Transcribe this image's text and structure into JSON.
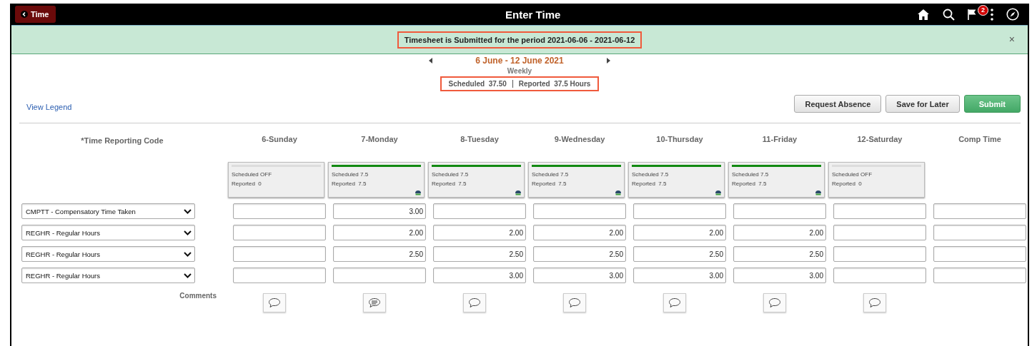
{
  "header": {
    "back_label": "Time",
    "title": "Enter Time",
    "notification_count": "2"
  },
  "banner": {
    "message": "Timesheet is Submitted for the period 2021-06-06 - 2021-06-12",
    "close": "×"
  },
  "period": {
    "range": "6 June - 12 June 2021",
    "view": "Weekly",
    "scheduled_label": "Scheduled",
    "scheduled_value": "37.50",
    "reported_label": "Reported",
    "reported_value": "37.5 Hours"
  },
  "view_legend": "View Legend",
  "buttons": [
    {
      "label": "Request Absence",
      "kind": "secondary"
    },
    {
      "label": "Save for Later",
      "kind": "secondary"
    },
    {
      "label": "Submit",
      "kind": "primary"
    }
  ],
  "code_column": "*Time Reporting Code",
  "columns": [
    "6-Sunday",
    "7-Monday",
    "8-Tuesday",
    "9-Wednesday",
    "10-Thursday",
    "11-Friday",
    "12-Saturday",
    "Comp Time"
  ],
  "day_summaries": [
    {
      "scheduled": "Scheduled OFF",
      "reported": "Reported  0",
      "complete": false
    },
    {
      "scheduled": "Scheduled 7.5",
      "reported": "Reported  7.5",
      "complete": true
    },
    {
      "scheduled": "Scheduled 7.5",
      "reported": "Reported  7.5",
      "complete": true
    },
    {
      "scheduled": "Scheduled 7.5",
      "reported": "Reported  7.5",
      "complete": true
    },
    {
      "scheduled": "Scheduled 7.5",
      "reported": "Reported  7.5",
      "complete": true
    },
    {
      "scheduled": "Scheduled 7.5",
      "reported": "Reported  7.5",
      "complete": true
    },
    {
      "scheduled": "Scheduled OFF",
      "reported": "Reported  0",
      "complete": false
    }
  ],
  "rows": [
    {
      "code": "CMPTT - Compensatory Time Taken",
      "hours": [
        {
          "kind": "blank"
        },
        {
          "kind": "entry",
          "value": "3.00"
        },
        {
          "kind": "blank"
        },
        {
          "kind": "blank"
        },
        {
          "kind": "blank"
        },
        {
          "kind": "blank"
        },
        {
          "kind": "blank"
        },
        {
          "kind": "blank"
        }
      ]
    },
    {
      "code": "REGHR - Regular Hours",
      "hours": [
        {
          "kind": "blank"
        },
        {
          "kind": "entry",
          "value": "2.00"
        },
        {
          "kind": "entry",
          "value": "2.00"
        },
        {
          "kind": "entry",
          "value": "2.00"
        },
        {
          "kind": "entry",
          "value": "2.00"
        },
        {
          "kind": "entry",
          "value": "2.00"
        },
        {
          "kind": "blank"
        },
        {
          "kind": "blank"
        }
      ]
    },
    {
      "code": "REGHR - Regular Hours",
      "hours": [
        {
          "kind": "blank"
        },
        {
          "kind": "entry",
          "value": "2.50"
        },
        {
          "kind": "entry",
          "value": "2.50"
        },
        {
          "kind": "entry",
          "value": "2.50"
        },
        {
          "kind": "entry",
          "value": "2.50"
        },
        {
          "kind": "entry",
          "value": "2.50"
        },
        {
          "kind": "blank"
        },
        {
          "kind": "blank"
        }
      ]
    },
    {
      "code": "REGHR - Regular Hours",
      "hours": [
        {
          "kind": "blank"
        },
        {
          "kind": "blank"
        },
        {
          "kind": "entry",
          "value": "3.00"
        },
        {
          "kind": "entry",
          "value": "3.00"
        },
        {
          "kind": "entry",
          "value": "3.00"
        },
        {
          "kind": "entry",
          "value": "3.00"
        },
        {
          "kind": "blank"
        },
        {
          "kind": "blank"
        }
      ]
    }
  ],
  "comments_label": "Comments",
  "comments": [
    {
      "has_comment": false
    },
    {
      "has_comment": true
    },
    {
      "has_comment": false
    },
    {
      "has_comment": false
    },
    {
      "has_comment": false
    },
    {
      "has_comment": false
    },
    {
      "has_comment": false
    }
  ]
}
